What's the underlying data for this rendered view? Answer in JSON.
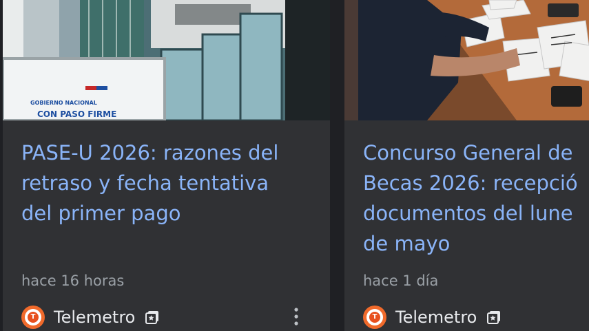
{
  "cards": [
    {
      "headline": "PASE-U 2026: razones del\nretraso y fecha tentativa\ndel primer pago",
      "time": "hace 16 horas",
      "source": "Telemetro",
      "thumbnail_text": {
        "line1": "GOBIERNO NACIONAL",
        "line2": "CON PASO FIRME"
      },
      "more_icon": "more-vert-icon"
    },
    {
      "headline": "Concurso General de\nBecas 2026: recepció\ndocumentos del lune\nde mayo",
      "time": "hace 1 día",
      "source": "Telemetro"
    }
  ],
  "colors": {
    "background": "#1f2024",
    "card": "#303134",
    "headline": "#8ab4f8",
    "meta_text": "#9aa0a6",
    "source_text": "#e8eaed",
    "logo": "#f16a2b"
  }
}
